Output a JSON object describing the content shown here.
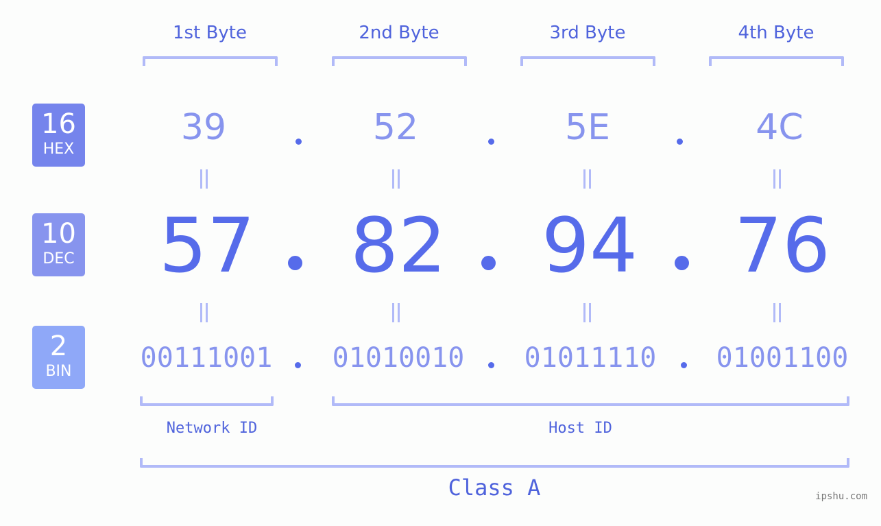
{
  "bytes": [
    {
      "label": "1st Byte",
      "hex": "39",
      "dec": "57",
      "bin": "00111001"
    },
    {
      "label": "2nd Byte",
      "hex": "52",
      "dec": "82",
      "bin": "01010010"
    },
    {
      "label": "3rd Byte",
      "hex": "5E",
      "dec": "94",
      "bin": "01011110"
    },
    {
      "label": "4th Byte",
      "hex": "4C",
      "dec": "76",
      "bin": "01001100"
    }
  ],
  "bases": {
    "hex": {
      "num": "16",
      "name": "HEX",
      "color": "#7584ec"
    },
    "dec": {
      "num": "10",
      "name": "DEC",
      "color": "#8794ee"
    },
    "bin": {
      "num": "2",
      "name": "BIN",
      "color": "#8fa8f8"
    }
  },
  "separator": ".",
  "segments": {
    "network": "Network ID",
    "host": "Host ID"
  },
  "ip_class": "Class A",
  "watermark": "ipshu.com",
  "colors": {
    "accent": "#566bea",
    "light_text": "#8794ee",
    "bracket": "#b1baf8",
    "label": "#4f63dc"
  }
}
